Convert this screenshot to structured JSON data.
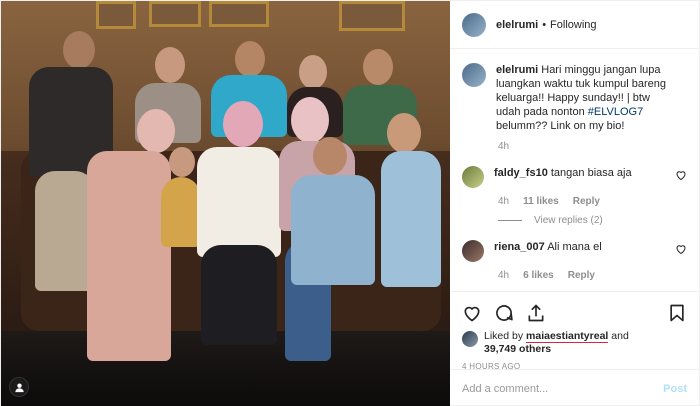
{
  "post": {
    "username": "elelrumi",
    "follow_status": "Following",
    "separator": "•"
  },
  "caption": {
    "username": "elelrumi",
    "text_before": "Hari minggu jangan lupa luangkan waktu tuk kumpul bareng keluarga!! Happy sunday!! | btw udah pada nonton ",
    "hashtag": "#ELVLOG7",
    "text_after": " belumm?? Link on my bio!",
    "time": "4h"
  },
  "comments": [
    {
      "username": "faldy_fs10",
      "text": "tangan biasa aja",
      "time": "4h",
      "likes": "11 likes",
      "reply_label": "Reply",
      "view_replies": "View replies (2)"
    },
    {
      "username": "riena_007",
      "text": "Ali mana el",
      "time": "4h",
      "likes": "6 likes",
      "reply_label": "Reply"
    }
  ],
  "likes": {
    "prefix": "Liked by",
    "user": "maiaestiantyreal",
    "suffix": "and",
    "count": "39,749 others"
  },
  "timestamp": "4 HOURS AGO",
  "add_comment": {
    "placeholder": "Add a comment...",
    "post_label": "Post"
  },
  "icons": {
    "like": "heart-icon",
    "comment": "comment-icon",
    "share": "share-icon",
    "save": "bookmark-icon",
    "tag": "person-tag-icon"
  },
  "colors": {
    "hashtag": "#00376b",
    "post_button": "#b2dffc",
    "muted": "#8e8e8e"
  }
}
